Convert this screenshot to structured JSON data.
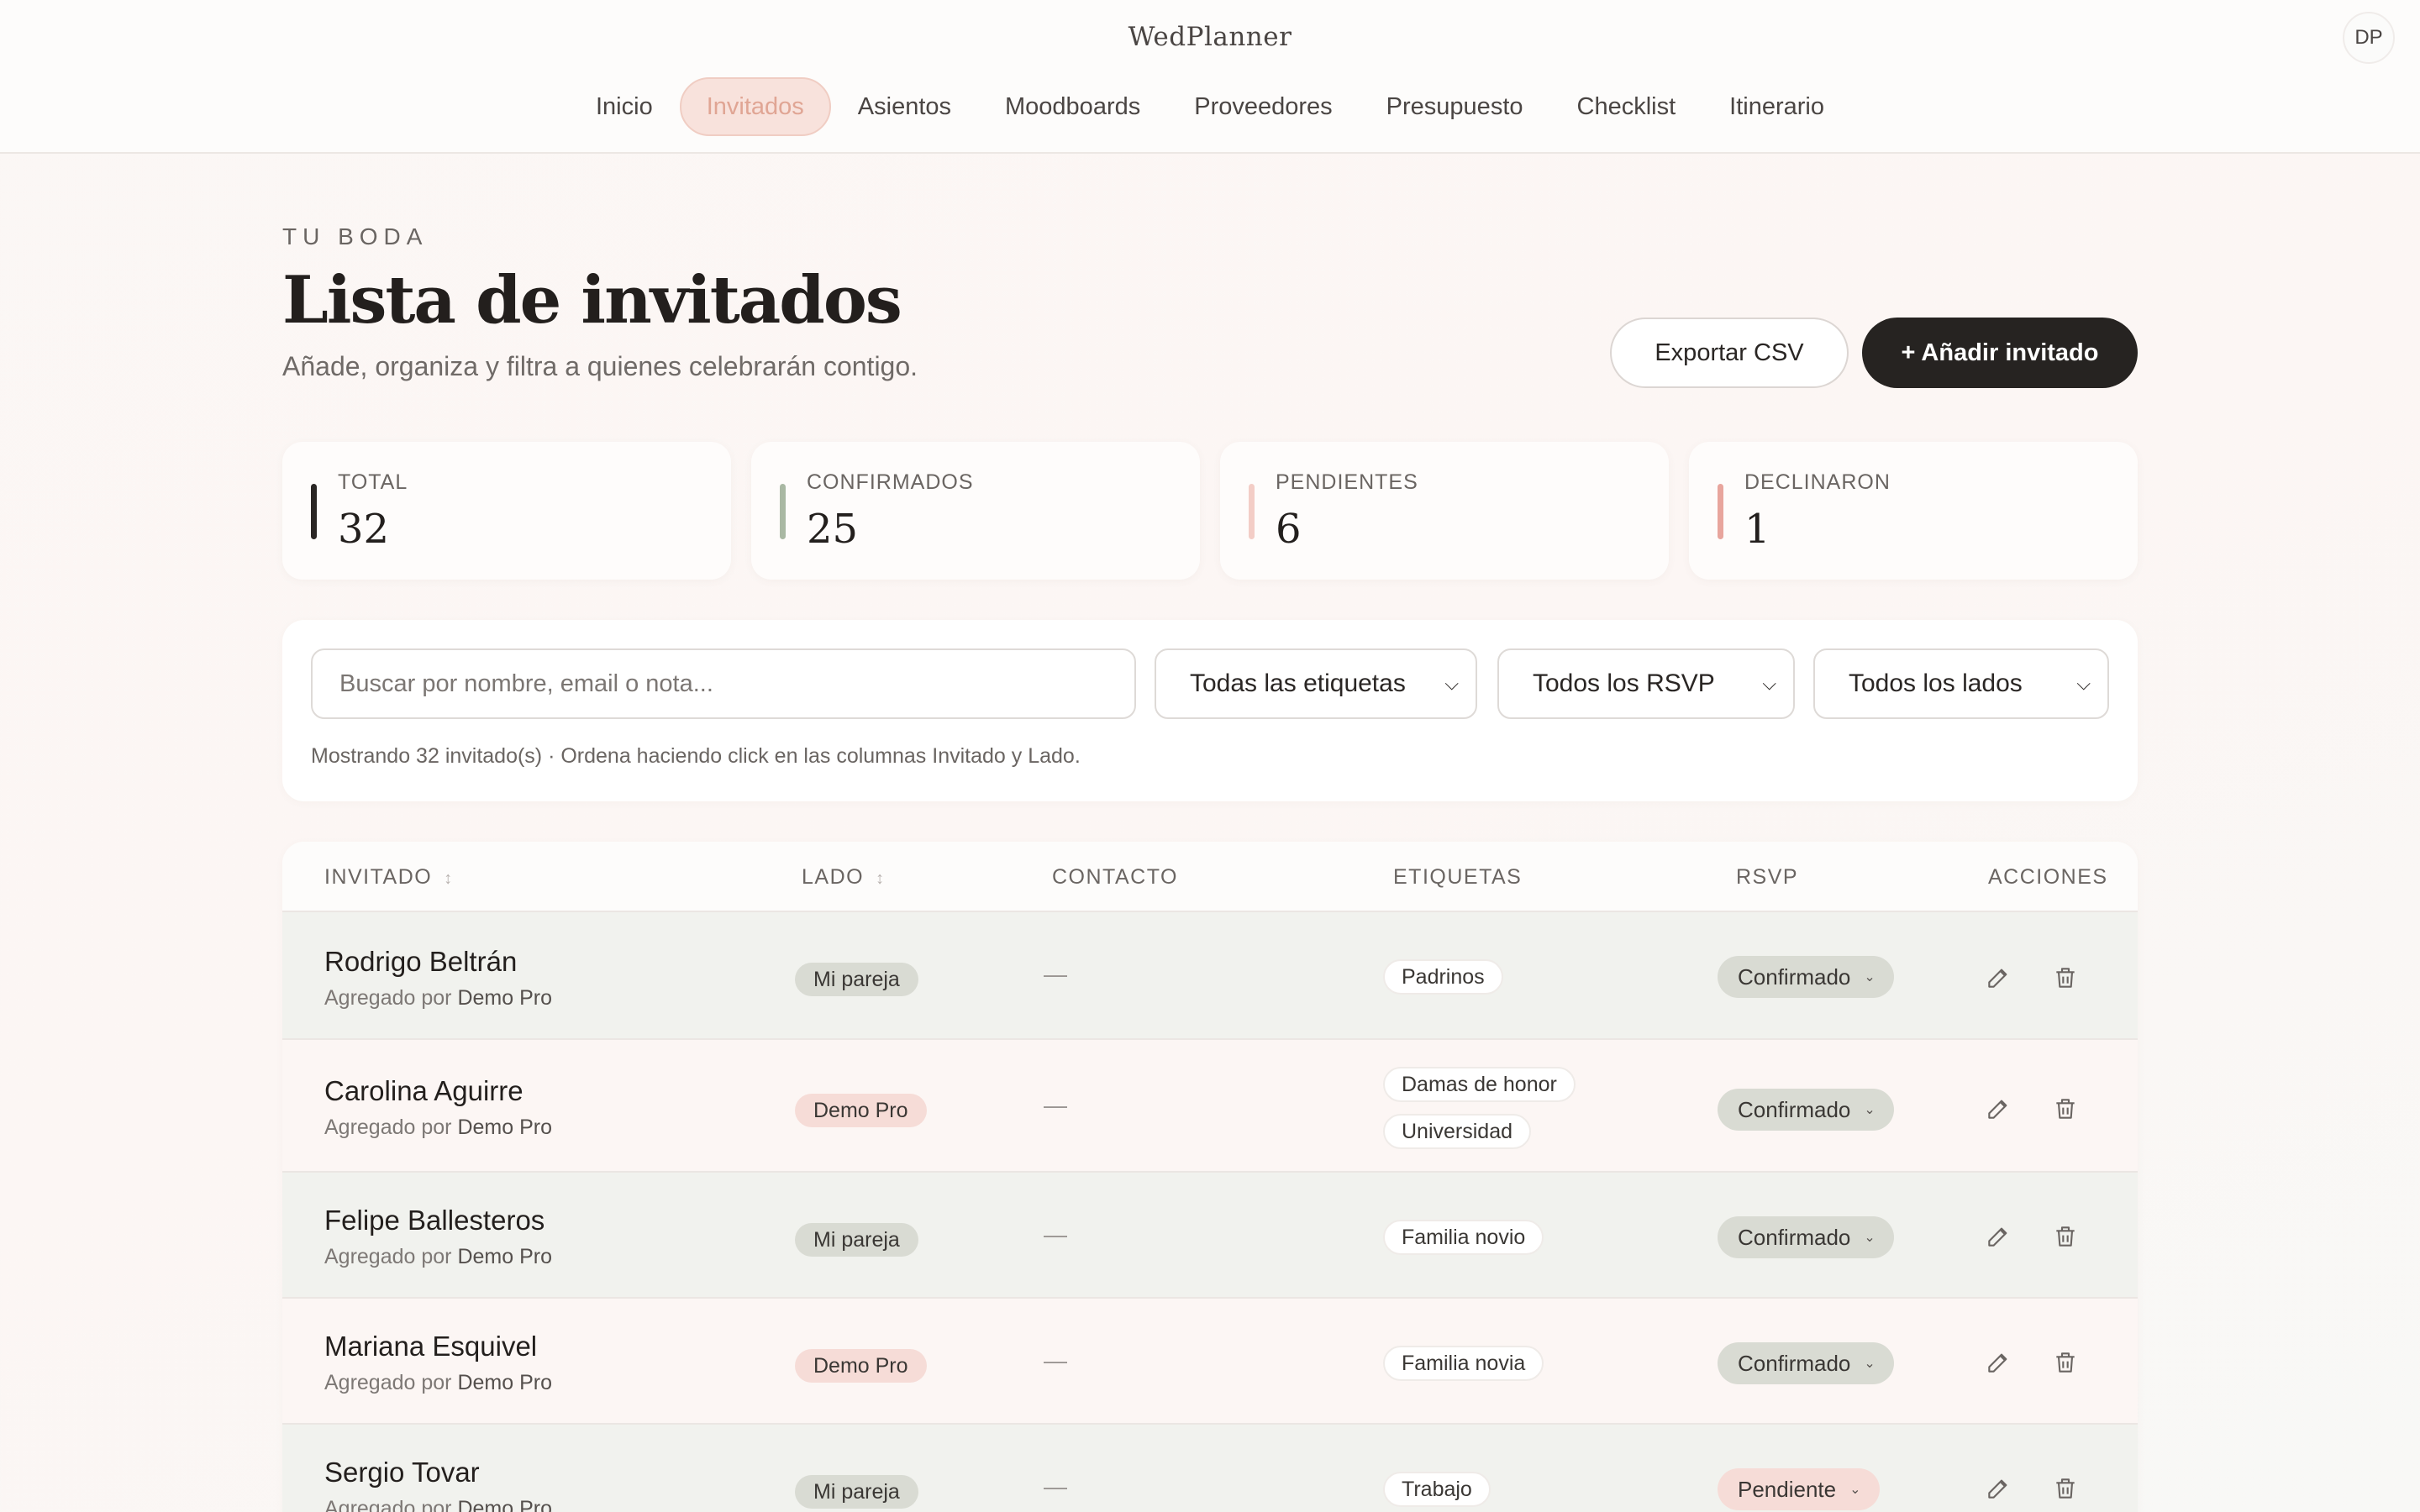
{
  "header": {
    "brand": "WedPlanner",
    "avatar_initials": "DP",
    "nav": [
      {
        "label": "Inicio",
        "active": false
      },
      {
        "label": "Invitados",
        "active": true
      },
      {
        "label": "Asientos",
        "active": false
      },
      {
        "label": "Moodboards",
        "active": false
      },
      {
        "label": "Proveedores",
        "active": false
      },
      {
        "label": "Presupuesto",
        "active": false
      },
      {
        "label": "Checklist",
        "active": false
      },
      {
        "label": "Itinerario",
        "active": false
      }
    ]
  },
  "page": {
    "eyebrow": "TU BODA",
    "title": "Lista de invitados",
    "subtitle": "Añade, organiza y filtra a quienes celebrarán contigo.",
    "export_label": "Exportar CSV",
    "add_label": "+ Añadir invitado"
  },
  "stats": [
    {
      "label": "TOTAL",
      "value": "32",
      "color": "#2a2624"
    },
    {
      "label": "CONFIRMADOS",
      "value": "25",
      "color": "#a9b8a3"
    },
    {
      "label": "PENDIENTES",
      "value": "6",
      "color": "#f3cdc6"
    },
    {
      "label": "DECLINARON",
      "value": "1",
      "color": "#e8a59d"
    }
  ],
  "filters": {
    "search_placeholder": "Buscar por nombre, email o nota...",
    "tags_select": "Todas las etiquetas",
    "rsvp_select": "Todos los RSVP",
    "side_select": "Todos los lados",
    "note": "Mostrando 32 invitado(s) · Ordena haciendo click en las columnas Invitado y Lado."
  },
  "table": {
    "headers": {
      "guest": "INVITADO",
      "side": "LADO",
      "contact": "CONTACTO",
      "tags": "ETIQUETAS",
      "rsvp": "RSVP",
      "actions": "ACCIONES"
    },
    "sort_glyph": "↕",
    "added_by_prefix": "Agregado por",
    "rows": [
      {
        "name": "Rodrigo Beltrán",
        "added_by": "Demo Pro",
        "side": "Mi pareja",
        "contact": "—",
        "tags": [
          "Padrinos"
        ],
        "rsvp": "Confirmado"
      },
      {
        "name": "Carolina Aguirre",
        "added_by": "Demo Pro",
        "side": "Demo Pro",
        "contact": "—",
        "tags": [
          "Damas de honor",
          "Universidad"
        ],
        "rsvp": "Confirmado"
      },
      {
        "name": "Felipe Ballesteros",
        "added_by": "Demo Pro",
        "side": "Mi pareja",
        "contact": "—",
        "tags": [
          "Familia novio"
        ],
        "rsvp": "Confirmado"
      },
      {
        "name": "Mariana Esquivel",
        "added_by": "Demo Pro",
        "side": "Demo Pro",
        "contact": "—",
        "tags": [
          "Familia novia"
        ],
        "rsvp": "Confirmado"
      },
      {
        "name": "Sergio Tovar",
        "added_by": "Demo Pro",
        "side": "Mi pareja",
        "contact": "—",
        "tags": [
          "Trabajo"
        ],
        "rsvp": "Pendiente"
      }
    ]
  }
}
